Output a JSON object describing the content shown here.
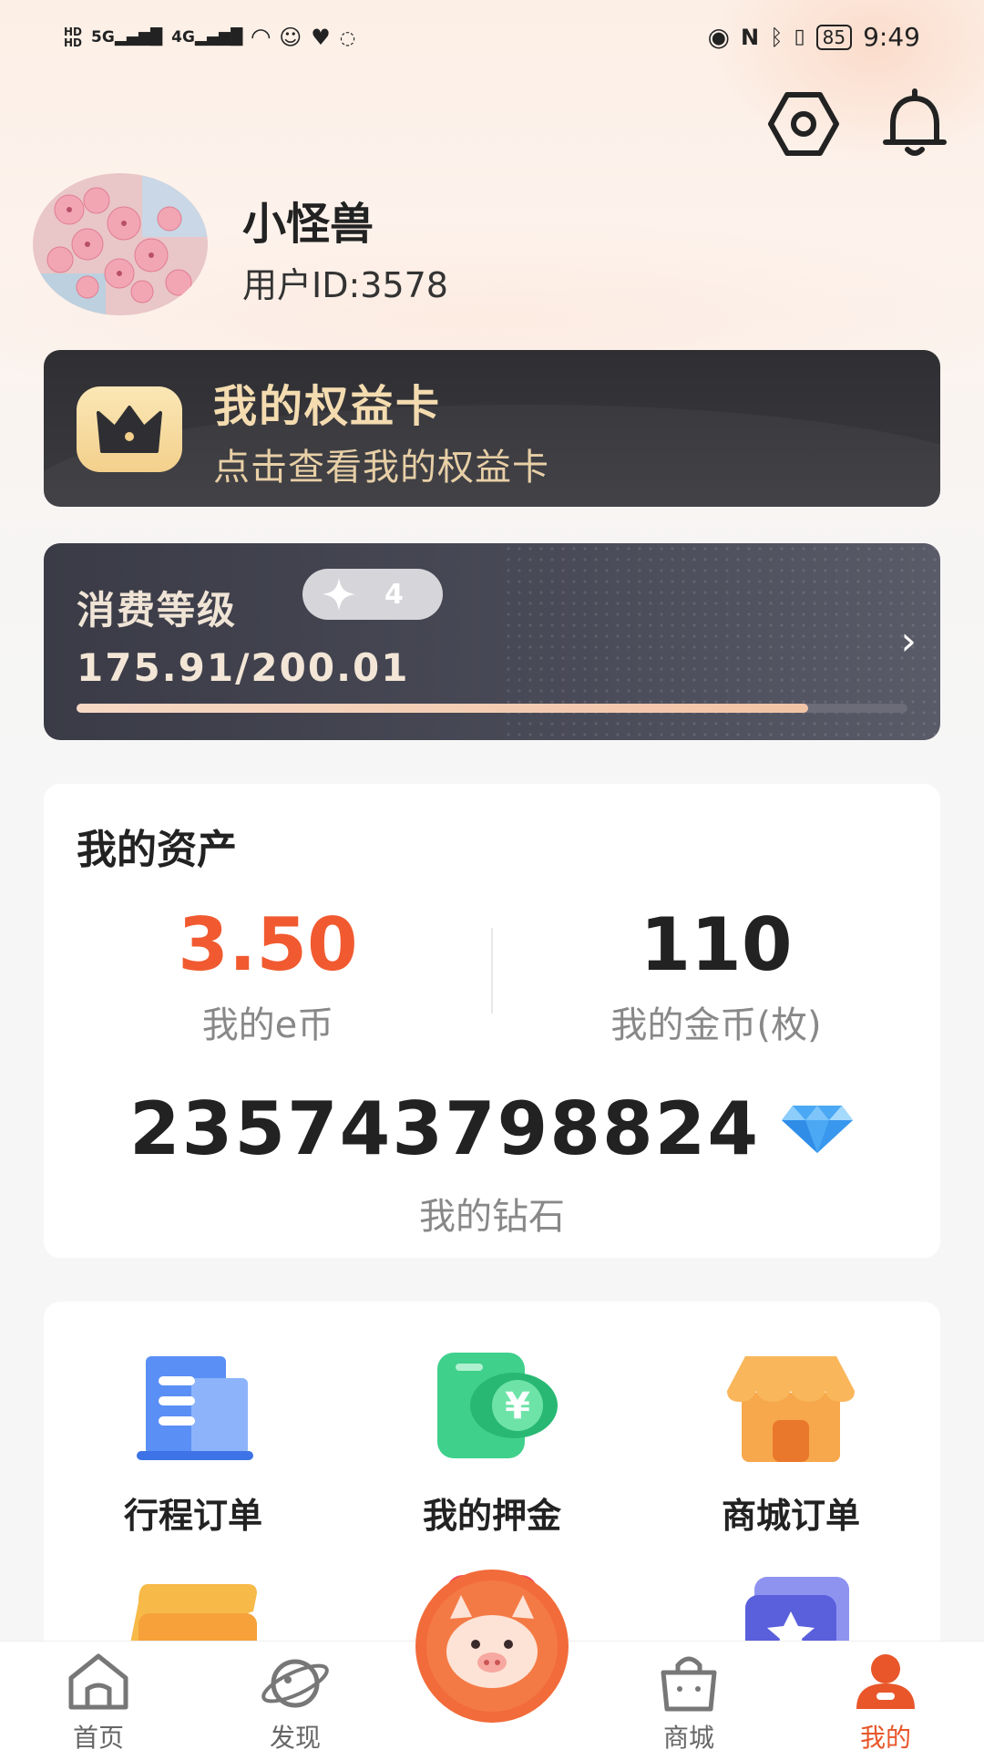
{
  "status_bar": {
    "left_signals": [
      "HD",
      "5G",
      "4G"
    ],
    "time": "9:49",
    "battery": "85"
  },
  "header": {
    "settings_icon": "settings-hexagon-icon",
    "notification_icon": "bell-icon"
  },
  "profile": {
    "name": "小怪兽",
    "user_id": "用户ID:3578"
  },
  "rights_card": {
    "title": "我的权益卡",
    "subtitle": "点击查看我的权益卡"
  },
  "level_card": {
    "title": "消费等级",
    "level": "4",
    "value": "175.91/200.01",
    "progress": 0.88
  },
  "assets": {
    "title": "我的资产",
    "ecoin_value": "3.50",
    "ecoin_label": "我的e币",
    "gold_value": "110",
    "gold_label": "我的金币(枚)",
    "diamond_value": "235743798824",
    "diamond_label": "我的钻石"
  },
  "services": [
    {
      "label": "行程订单",
      "icon": "trip-order-icon"
    },
    {
      "label": "我的押金",
      "icon": "deposit-icon"
    },
    {
      "label": "商城订单",
      "icon": "shop-order-icon"
    }
  ],
  "bottom_nav": [
    {
      "label": "首页",
      "icon": "home-icon"
    },
    {
      "label": "发现",
      "icon": "discover-planet-icon"
    },
    {
      "label": "商城",
      "icon": "shop-bag-icon"
    },
    {
      "label": "我的",
      "icon": "profile-icon"
    }
  ],
  "colors": {
    "accent": "#f15a30",
    "card_dark": "#2f2f33",
    "gold_text": "#f4dcb0"
  }
}
